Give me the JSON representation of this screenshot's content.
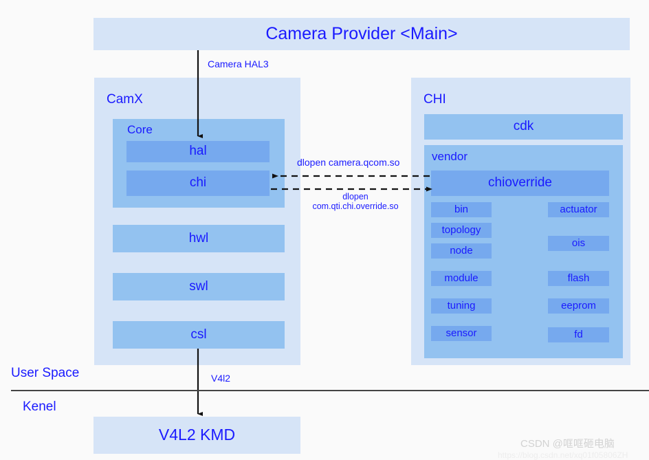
{
  "diagram": {
    "title_banner": {
      "label": "Camera Provider <Main>"
    },
    "camx": {
      "title": "CamX",
      "core": {
        "title": "Core",
        "modules": [
          {
            "label": "hal"
          },
          {
            "label": "chi"
          }
        ]
      },
      "layers": [
        {
          "label": "hwl"
        },
        {
          "label": "swl"
        },
        {
          "label": "csl"
        }
      ]
    },
    "chi": {
      "title": "CHI",
      "cdk": {
        "label": "cdk"
      },
      "vendor": {
        "title": "vendor",
        "chioverride": {
          "label": "chioverride"
        },
        "left_column": [
          {
            "label": "bin"
          },
          {
            "label": "topology"
          },
          {
            "label": "node"
          },
          {
            "label": "module"
          },
          {
            "label": "tuning"
          },
          {
            "label": "sensor"
          }
        ],
        "right_column": [
          {
            "label": "actuator"
          },
          {
            "label": "ois"
          },
          {
            "label": "flash"
          },
          {
            "label": "eeprom"
          },
          {
            "label": "fd"
          }
        ]
      }
    },
    "edges": [
      {
        "name": "camera-hal3",
        "label": "Camera HAL3"
      },
      {
        "name": "dlopen-camera-qcom",
        "label": "dlopen camera.qcom.so"
      },
      {
        "name": "dlopen-chi-override",
        "label_line1": "dlopen",
        "label_line2": "com.qti.chi.override.so"
      },
      {
        "name": "v4l2",
        "label": "V4l2"
      }
    ],
    "space_labels": {
      "user_space": "User Space",
      "kernel": "Kenel"
    },
    "kmd": {
      "label": "V4L2 KMD"
    },
    "watermark": {
      "text": "CSDN @哐哐砸电脑",
      "subtext": "https://blog.csdn.net/xq01f05806ZH"
    },
    "colors": {
      "text_blue": "#1a1aff",
      "tone_light": "#d6e4f7",
      "tone_mid": "#93c2f0",
      "tone_dark": "#76a9ee",
      "background": "#fafafa",
      "line": "#333333"
    }
  }
}
